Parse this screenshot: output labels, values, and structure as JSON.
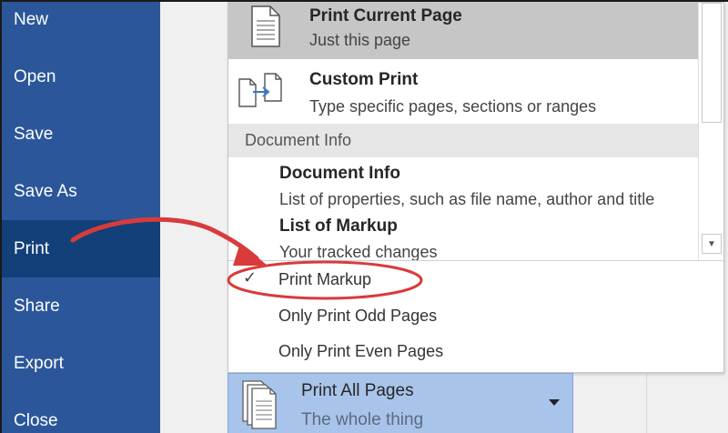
{
  "sidebar": {
    "items": [
      {
        "label": "New"
      },
      {
        "label": "Open"
      },
      {
        "label": "Save"
      },
      {
        "label": "Save As"
      },
      {
        "label": "Print"
      },
      {
        "label": "Share"
      },
      {
        "label": "Export"
      },
      {
        "label": "Close"
      }
    ],
    "active": "Print",
    "bg_color": "#2b579a",
    "active_color": "#124078"
  },
  "dropdown": {
    "options": [
      {
        "title": "Print Current Page",
        "desc": "Just this page",
        "icon": "single-page-icon",
        "selected": true
      },
      {
        "title": "Custom Print",
        "desc": "Type specific pages, sections or ranges",
        "icon": "custom-print-icon",
        "selected": false
      }
    ],
    "section_header": "Document Info",
    "doc_options": [
      {
        "title": "Document Info",
        "desc": "List of properties, such as file name, author and title"
      },
      {
        "title": "List of Markup",
        "desc": "Your tracked changes"
      }
    ],
    "check_items": [
      {
        "label": "Print Markup",
        "checked": true
      },
      {
        "label": "Only Print Odd Pages",
        "checked": false
      },
      {
        "label": "Only Print Even Pages",
        "checked": false
      }
    ],
    "check_glyph": "✓",
    "scroll_down_glyph": "▼"
  },
  "pages_selector": {
    "title": "Print All Pages",
    "desc": "The whole thing",
    "icon": "stacked-pages-icon",
    "bg_color": "#a9c4ea"
  },
  "annotation": {
    "color": "#d93b3b"
  }
}
